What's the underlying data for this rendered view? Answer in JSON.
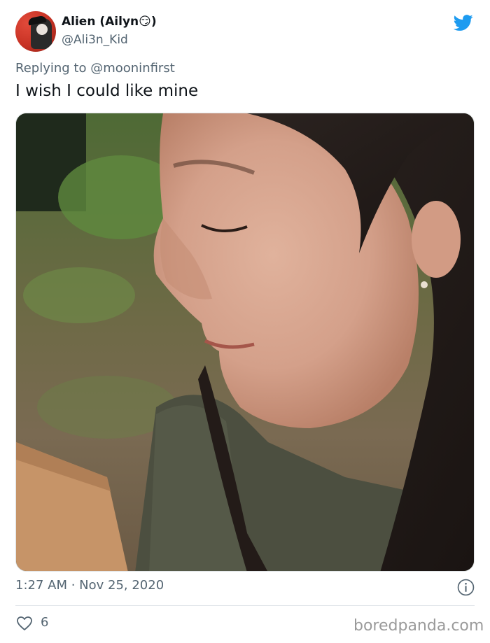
{
  "author": {
    "display_name": "Alien (Ailyn",
    "display_name_emoji": "😏",
    "display_name_close": ")",
    "handle": "@Ali3n_Kid"
  },
  "reply_context": {
    "prefix": "Replying to",
    "target": "@mooninfirst"
  },
  "tweet": {
    "text": "I wish I could like mine"
  },
  "meta": {
    "timestamp": "1:27 AM · Nov 25, 2020"
  },
  "engagement": {
    "likes": "6"
  },
  "watermark": "boredpanda.com",
  "icons": {
    "logo": "twitter-bird-icon",
    "info": "info-icon",
    "like": "heart-icon"
  },
  "colors": {
    "brand": "#1d9bf0",
    "muted_text": "#536471",
    "text": "#0f1419"
  }
}
